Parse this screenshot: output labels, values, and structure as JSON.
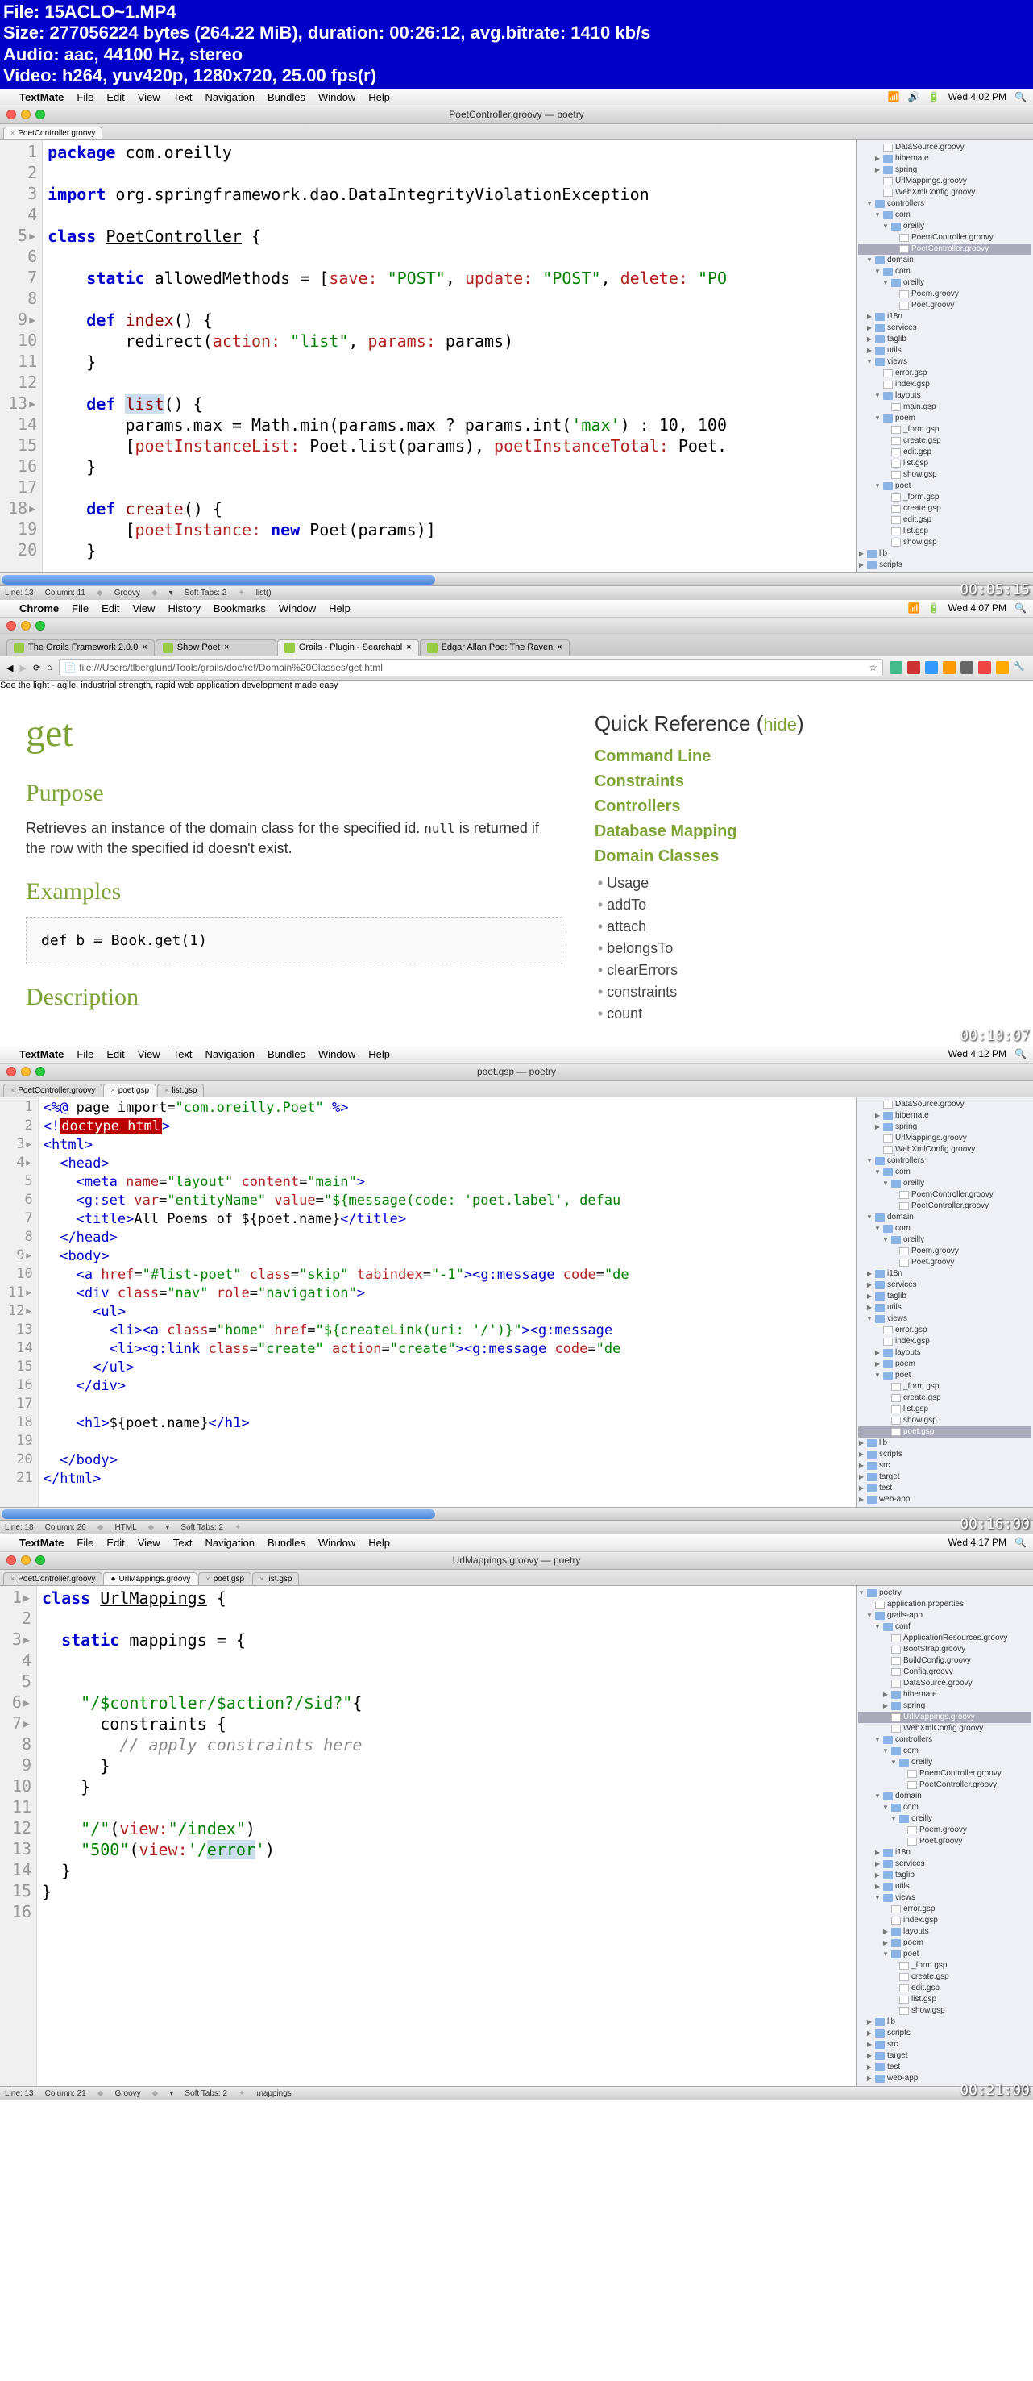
{
  "video_meta": {
    "file": "File: 15ACLO~1.MP4",
    "size": "Size: 277056224 bytes (264.22 MiB), duration: 00:26:12, avg.bitrate: 1410 kb/s",
    "audio": "Audio: aac, 44100 Hz, stereo",
    "video": "Video: h264, yuv420p, 1280x720, 25.00 fps(r)"
  },
  "panes": [
    {
      "menubar": {
        "app": "TextMate",
        "items": [
          "File",
          "Edit",
          "View",
          "Text",
          "Navigation",
          "Bundles",
          "Window",
          "Help"
        ],
        "time": "Wed 4:02 PM"
      },
      "window_title": "PoetController.groovy — poetry",
      "tabs": [
        {
          "label": "PoetController.groovy",
          "active": true
        }
      ],
      "timestamp": "00:05:15",
      "status": {
        "line": "Line: 13",
        "col": "Column: 11",
        "lang": "Groovy",
        "tabs": "Soft Tabs: 2",
        "extra": "list()"
      },
      "tree": [
        {
          "d": 2,
          "t": "f",
          "l": "DataSource.groovy"
        },
        {
          "d": 2,
          "t": "d",
          "l": "hibernate",
          "a": "r"
        },
        {
          "d": 2,
          "t": "d",
          "l": "spring",
          "a": "r"
        },
        {
          "d": 2,
          "t": "f",
          "l": "UrlMappings.groovy"
        },
        {
          "d": 2,
          "t": "f",
          "l": "WebXmlConfig.groovy"
        },
        {
          "d": 1,
          "t": "d",
          "l": "controllers",
          "a": "d"
        },
        {
          "d": 2,
          "t": "d",
          "l": "com",
          "a": "d"
        },
        {
          "d": 3,
          "t": "d",
          "l": "oreilly",
          "a": "d"
        },
        {
          "d": 4,
          "t": "f",
          "l": "PoemController.groovy"
        },
        {
          "d": 4,
          "t": "f",
          "l": "PoetController.groovy",
          "sel": true
        },
        {
          "d": 1,
          "t": "d",
          "l": "domain",
          "a": "d"
        },
        {
          "d": 2,
          "t": "d",
          "l": "com",
          "a": "d"
        },
        {
          "d": 3,
          "t": "d",
          "l": "oreilly",
          "a": "d"
        },
        {
          "d": 4,
          "t": "f",
          "l": "Poem.groovy"
        },
        {
          "d": 4,
          "t": "f",
          "l": "Poet.groovy"
        },
        {
          "d": 1,
          "t": "d",
          "l": "i18n",
          "a": "r"
        },
        {
          "d": 1,
          "t": "d",
          "l": "services",
          "a": "r"
        },
        {
          "d": 1,
          "t": "d",
          "l": "taglib",
          "a": "r"
        },
        {
          "d": 1,
          "t": "d",
          "l": "utils",
          "a": "r"
        },
        {
          "d": 1,
          "t": "d",
          "l": "views",
          "a": "d"
        },
        {
          "d": 2,
          "t": "f",
          "l": "error.gsp"
        },
        {
          "d": 2,
          "t": "f",
          "l": "index.gsp"
        },
        {
          "d": 2,
          "t": "d",
          "l": "layouts",
          "a": "d"
        },
        {
          "d": 3,
          "t": "f",
          "l": "main.gsp"
        },
        {
          "d": 2,
          "t": "d",
          "l": "poem",
          "a": "d"
        },
        {
          "d": 3,
          "t": "f",
          "l": "_form.gsp"
        },
        {
          "d": 3,
          "t": "f",
          "l": "create.gsp"
        },
        {
          "d": 3,
          "t": "f",
          "l": "edit.gsp"
        },
        {
          "d": 3,
          "t": "f",
          "l": "list.gsp"
        },
        {
          "d": 3,
          "t": "f",
          "l": "show.gsp"
        },
        {
          "d": 2,
          "t": "d",
          "l": "poet",
          "a": "d"
        },
        {
          "d": 3,
          "t": "f",
          "l": "_form.gsp"
        },
        {
          "d": 3,
          "t": "f",
          "l": "create.gsp"
        },
        {
          "d": 3,
          "t": "f",
          "l": "edit.gsp"
        },
        {
          "d": 3,
          "t": "f",
          "l": "list.gsp"
        },
        {
          "d": 3,
          "t": "f",
          "l": "show.gsp"
        },
        {
          "d": 0,
          "t": "d",
          "l": "lib",
          "a": "r"
        },
        {
          "d": 0,
          "t": "d",
          "l": "scripts",
          "a": "r"
        }
      ]
    },
    {
      "menubar": {
        "app": "Chrome",
        "items": [
          "File",
          "Edit",
          "View",
          "History",
          "Bookmarks",
          "Window",
          "Help"
        ],
        "time": "Wed 4:07 PM"
      },
      "timestamp": "00:10:07",
      "chrome_tabs": [
        {
          "label": "The Grails Framework 2.0.0",
          "active": false
        },
        {
          "label": "Show Poet",
          "active": false
        },
        {
          "label": "Grails - Plugin - Searchabl",
          "active": true
        },
        {
          "label": "Edgar Allan Poe: The Raven",
          "active": false
        }
      ],
      "url": "file:///Users/tlberglund/Tools/grails/doc/ref/Domain%20Classes/get.html",
      "tagline": "See the light - agile, industrial strength, rapid web application development made easy",
      "doc": {
        "title": "get",
        "h_purpose": "Purpose",
        "purpose_text": "Retrieves an instance of the domain class for the specified id. ",
        "purpose_mono": "null",
        "purpose_text2": " is returned if the row with the specified id doesn't exist.",
        "h_examples": "Examples",
        "example_code": "def b = Book.get(1)",
        "h_description": "Description"
      },
      "quickref": {
        "title": "Quick Reference",
        "hide": "hide",
        "cats": [
          "Command Line",
          "Constraints",
          "Controllers",
          "Database Mapping",
          "Domain Classes"
        ],
        "items": [
          "Usage",
          "addTo",
          "attach",
          "belongsTo",
          "clearErrors",
          "constraints",
          "count"
        ]
      }
    },
    {
      "menubar": {
        "app": "TextMate",
        "items": [
          "File",
          "Edit",
          "View",
          "Text",
          "Navigation",
          "Bundles",
          "Window",
          "Help"
        ],
        "time": "Wed 4:12 PM"
      },
      "window_title": "poet.gsp — poetry",
      "tabs": [
        {
          "label": "PoetController.groovy",
          "active": false
        },
        {
          "label": "poet.gsp",
          "active": true
        },
        {
          "label": "list.gsp",
          "active": false
        }
      ],
      "timestamp": "00:16:00",
      "status": {
        "line": "Line: 18",
        "col": "Column: 26",
        "lang": "HTML",
        "tabs": "Soft Tabs: 2",
        "extra": ""
      },
      "tree": [
        {
          "d": 2,
          "t": "f",
          "l": "DataSource.groovy"
        },
        {
          "d": 2,
          "t": "d",
          "l": "hibernate",
          "a": "r"
        },
        {
          "d": 2,
          "t": "d",
          "l": "spring",
          "a": "r"
        },
        {
          "d": 2,
          "t": "f",
          "l": "UrlMappings.groovy"
        },
        {
          "d": 2,
          "t": "f",
          "l": "WebXmlConfig.groovy"
        },
        {
          "d": 1,
          "t": "d",
          "l": "controllers",
          "a": "d"
        },
        {
          "d": 2,
          "t": "d",
          "l": "com",
          "a": "d"
        },
        {
          "d": 3,
          "t": "d",
          "l": "oreilly",
          "a": "d"
        },
        {
          "d": 4,
          "t": "f",
          "l": "PoemController.groovy"
        },
        {
          "d": 4,
          "t": "f",
          "l": "PoetController.groovy"
        },
        {
          "d": 1,
          "t": "d",
          "l": "domain",
          "a": "d"
        },
        {
          "d": 2,
          "t": "d",
          "l": "com",
          "a": "d"
        },
        {
          "d": 3,
          "t": "d",
          "l": "oreilly",
          "a": "d"
        },
        {
          "d": 4,
          "t": "f",
          "l": "Poem.groovy"
        },
        {
          "d": 4,
          "t": "f",
          "l": "Poet.groovy"
        },
        {
          "d": 1,
          "t": "d",
          "l": "i18n",
          "a": "r"
        },
        {
          "d": 1,
          "t": "d",
          "l": "services",
          "a": "r"
        },
        {
          "d": 1,
          "t": "d",
          "l": "taglib",
          "a": "r"
        },
        {
          "d": 1,
          "t": "d",
          "l": "utils",
          "a": "r"
        },
        {
          "d": 1,
          "t": "d",
          "l": "views",
          "a": "d"
        },
        {
          "d": 2,
          "t": "f",
          "l": "error.gsp"
        },
        {
          "d": 2,
          "t": "f",
          "l": "index.gsp"
        },
        {
          "d": 2,
          "t": "d",
          "l": "layouts",
          "a": "r"
        },
        {
          "d": 2,
          "t": "d",
          "l": "poem",
          "a": "r"
        },
        {
          "d": 2,
          "t": "d",
          "l": "poet",
          "a": "d"
        },
        {
          "d": 3,
          "t": "f",
          "l": "_form.gsp"
        },
        {
          "d": 3,
          "t": "f",
          "l": "create.gsp"
        },
        {
          "d": 3,
          "t": "f",
          "l": "list.gsp"
        },
        {
          "d": 3,
          "t": "f",
          "l": "show.gsp"
        },
        {
          "d": 3,
          "t": "f",
          "l": "poet.gsp",
          "sel": true
        },
        {
          "d": 0,
          "t": "d",
          "l": "lib",
          "a": "r"
        },
        {
          "d": 0,
          "t": "d",
          "l": "scripts",
          "a": "r"
        },
        {
          "d": 0,
          "t": "d",
          "l": "src",
          "a": "r"
        },
        {
          "d": 0,
          "t": "d",
          "l": "target",
          "a": "r"
        },
        {
          "d": 0,
          "t": "d",
          "l": "test",
          "a": "r"
        },
        {
          "d": 0,
          "t": "d",
          "l": "web-app",
          "a": "r"
        }
      ]
    },
    {
      "menubar": {
        "app": "TextMate",
        "items": [
          "File",
          "Edit",
          "View",
          "Text",
          "Navigation",
          "Bundles",
          "Window",
          "Help"
        ],
        "time": "Wed 4:17 PM"
      },
      "window_title": "UrlMappings.groovy — poetry",
      "tabs": [
        {
          "label": "PoetController.groovy",
          "active": false
        },
        {
          "label": "UrlMappings.groovy",
          "active": true
        },
        {
          "label": "poet.gsp",
          "active": false
        },
        {
          "label": "list.gsp",
          "active": false
        }
      ],
      "timestamp": "00:21:00",
      "status": {
        "line": "Line: 13",
        "col": "Column: 21",
        "lang": "Groovy",
        "tabs": "Soft Tabs: 2",
        "extra": "mappings"
      },
      "tree": [
        {
          "d": 0,
          "t": "d",
          "l": "poetry",
          "a": "d"
        },
        {
          "d": 1,
          "t": "f",
          "l": "application.properties"
        },
        {
          "d": 1,
          "t": "d",
          "l": "grails-app",
          "a": "d"
        },
        {
          "d": 2,
          "t": "d",
          "l": "conf",
          "a": "d"
        },
        {
          "d": 3,
          "t": "f",
          "l": "ApplicationResources.groovy"
        },
        {
          "d": 3,
          "t": "f",
          "l": "BootStrap.groovy"
        },
        {
          "d": 3,
          "t": "f",
          "l": "BuildConfig.groovy"
        },
        {
          "d": 3,
          "t": "f",
          "l": "Config.groovy"
        },
        {
          "d": 3,
          "t": "f",
          "l": "DataSource.groovy"
        },
        {
          "d": 3,
          "t": "d",
          "l": "hibernate",
          "a": "r"
        },
        {
          "d": 3,
          "t": "d",
          "l": "spring",
          "a": "r"
        },
        {
          "d": 3,
          "t": "f",
          "l": "UrlMappings.groovy",
          "sel": true
        },
        {
          "d": 3,
          "t": "f",
          "l": "WebXmlConfig.groovy"
        },
        {
          "d": 2,
          "t": "d",
          "l": "controllers",
          "a": "d"
        },
        {
          "d": 3,
          "t": "d",
          "l": "com",
          "a": "d"
        },
        {
          "d": 4,
          "t": "d",
          "l": "oreilly",
          "a": "d"
        },
        {
          "d": 5,
          "t": "f",
          "l": "PoemController.groovy"
        },
        {
          "d": 5,
          "t": "f",
          "l": "PoetController.groovy"
        },
        {
          "d": 2,
          "t": "d",
          "l": "domain",
          "a": "d"
        },
        {
          "d": 3,
          "t": "d",
          "l": "com",
          "a": "d"
        },
        {
          "d": 4,
          "t": "d",
          "l": "oreilly",
          "a": "d"
        },
        {
          "d": 5,
          "t": "f",
          "l": "Poem.groovy"
        },
        {
          "d": 5,
          "t": "f",
          "l": "Poet.groovy"
        },
        {
          "d": 2,
          "t": "d",
          "l": "i18n",
          "a": "r"
        },
        {
          "d": 2,
          "t": "d",
          "l": "services",
          "a": "r"
        },
        {
          "d": 2,
          "t": "d",
          "l": "taglib",
          "a": "r"
        },
        {
          "d": 2,
          "t": "d",
          "l": "utils",
          "a": "r"
        },
        {
          "d": 2,
          "t": "d",
          "l": "views",
          "a": "d"
        },
        {
          "d": 3,
          "t": "f",
          "l": "error.gsp"
        },
        {
          "d": 3,
          "t": "f",
          "l": "index.gsp"
        },
        {
          "d": 3,
          "t": "d",
          "l": "layouts",
          "a": "r"
        },
        {
          "d": 3,
          "t": "d",
          "l": "poem",
          "a": "r"
        },
        {
          "d": 3,
          "t": "d",
          "l": "poet",
          "a": "d"
        },
        {
          "d": 4,
          "t": "f",
          "l": "_form.gsp"
        },
        {
          "d": 4,
          "t": "f",
          "l": "create.gsp"
        },
        {
          "d": 4,
          "t": "f",
          "l": "edit.gsp"
        },
        {
          "d": 4,
          "t": "f",
          "l": "list.gsp"
        },
        {
          "d": 4,
          "t": "f",
          "l": "show.gsp"
        },
        {
          "d": 1,
          "t": "d",
          "l": "lib",
          "a": "r"
        },
        {
          "d": 1,
          "t": "d",
          "l": "scripts",
          "a": "r"
        },
        {
          "d": 1,
          "t": "d",
          "l": "src",
          "a": "r"
        },
        {
          "d": 1,
          "t": "d",
          "l": "target",
          "a": "r"
        },
        {
          "d": 1,
          "t": "d",
          "l": "test",
          "a": "r"
        },
        {
          "d": 1,
          "t": "d",
          "l": "web-app",
          "a": "r"
        }
      ]
    }
  ]
}
